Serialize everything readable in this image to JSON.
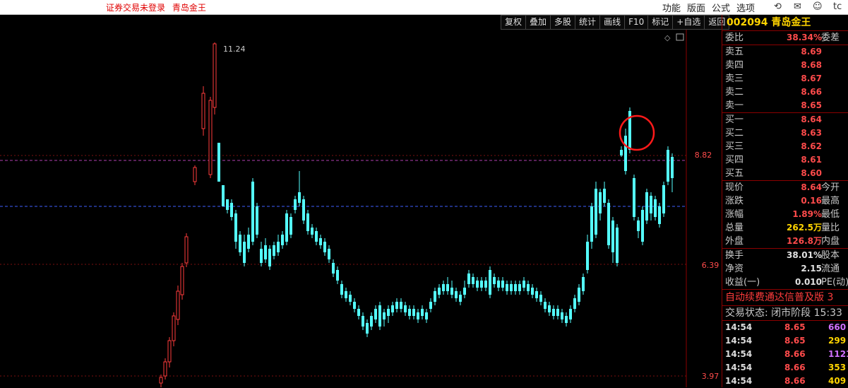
{
  "titlebar": {
    "not_logged": "证券交易未登录",
    "stock_name": "青岛金王",
    "menu": [
      "功能",
      "版面",
      "公式",
      "选项"
    ],
    "tail": "tc"
  },
  "toolbar": [
    "复权",
    "叠加",
    "多股",
    "统计",
    "画线",
    "F10",
    "标记",
    "+自选",
    "返回"
  ],
  "chart": {
    "price_labels": [
      "8.82",
      "6.39",
      "3.97"
    ],
    "peak_label": "11.24"
  },
  "panel": {
    "header": "002094 青岛金王",
    "weibi": {
      "label": "委比",
      "value": "38.34%",
      "label2": "委差"
    },
    "sell": [
      {
        "label": "卖五",
        "price": "8.69"
      },
      {
        "label": "卖四",
        "price": "8.68"
      },
      {
        "label": "卖三",
        "price": "8.67"
      },
      {
        "label": "卖二",
        "price": "8.66"
      },
      {
        "label": "卖一",
        "price": "8.65"
      }
    ],
    "buy": [
      {
        "label": "买一",
        "price": "8.64"
      },
      {
        "label": "买二",
        "price": "8.63"
      },
      {
        "label": "买三",
        "price": "8.62"
      },
      {
        "label": "买四",
        "price": "8.61"
      },
      {
        "label": "买五",
        "price": "8.60"
      }
    ],
    "stats": [
      {
        "label": "现价",
        "value": "8.64",
        "label2": "今开",
        "color": "#ff4b4b"
      },
      {
        "label": "涨跌",
        "value": "0.16",
        "label2": "最高",
        "color": "#ff4b4b"
      },
      {
        "label": "涨幅",
        "value": "1.89%",
        "label2": "最低",
        "color": "#ff4b4b"
      },
      {
        "label": "总量",
        "value": "262.5万",
        "label2": "量比",
        "color": "#ffd400"
      },
      {
        "label": "外盘",
        "value": "126.8万",
        "label2": "内盘",
        "color": "#ff4b4b"
      }
    ],
    "stats2": [
      {
        "label": "换手",
        "value": "38.01%",
        "label2": "股本",
        "color": "#e0e0e0"
      },
      {
        "label": "净资",
        "value": "2.15",
        "label2": "流通",
        "color": "#e0e0e0"
      },
      {
        "label": "收益(一)",
        "value": "0.010",
        "label2": "PE(动)",
        "color": "#e0e0e0"
      }
    ],
    "banner": "自动续费通达信普及版 3",
    "status": "交易状态: 闭市阶段 15:33",
    "trades": [
      {
        "time": "14:54",
        "price": "8.65",
        "vol": "660",
        "color": "#d070ff"
      },
      {
        "time": "14:54",
        "price": "8.65",
        "vol": "299",
        "color": "#ffd400"
      },
      {
        "time": "14:54",
        "price": "8.66",
        "vol": "1121",
        "color": "#d070ff"
      },
      {
        "time": "14:54",
        "price": "8.66",
        "vol": "353",
        "color": "#ffd400"
      },
      {
        "time": "14:54",
        "price": "8.66",
        "vol": "409",
        "color": "#ffd400"
      }
    ]
  }
}
